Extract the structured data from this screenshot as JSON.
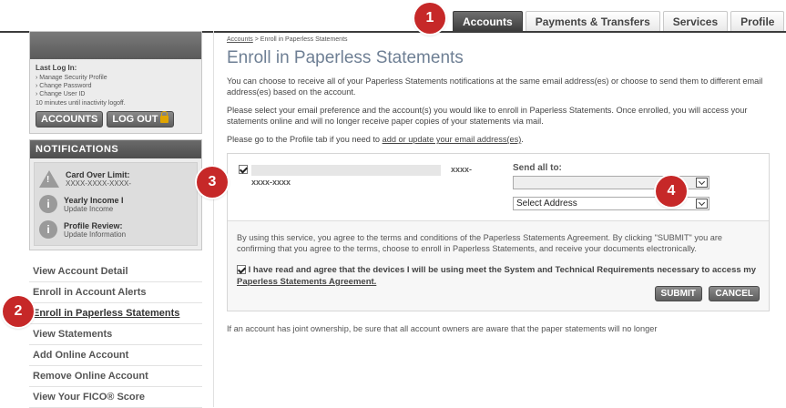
{
  "top_nav": {
    "tabs": [
      {
        "label": "Accounts"
      },
      {
        "label": "Payments & Transfers"
      },
      {
        "label": "Services"
      },
      {
        "label": "Profile"
      }
    ]
  },
  "badges": [
    "1",
    "2",
    "3",
    "4"
  ],
  "sidebar": {
    "last_login_label": "Last Log In:",
    "links": [
      "Manage Security Profile",
      "Change Password",
      "Change User ID"
    ],
    "timeout": "10 minutes until inactivity logoff.",
    "accounts_button": "ACCOUNTS",
    "logout_button": "LOG OUT",
    "notifications": {
      "title": "NOTIFICATIONS",
      "items": [
        {
          "title": "Card Over Limit:",
          "sub": "XXXX-XXXX-XXXX-"
        },
        {
          "title": "Yearly Income I",
          "sub": "Update Income"
        },
        {
          "title": "Profile Review:",
          "sub": "Update Information"
        }
      ]
    },
    "nav": [
      "View Account Detail",
      "Enroll in Account Alerts",
      "Enroll in Paperless Statements",
      "View Statements",
      "Add Online Account",
      "Remove Online Account",
      "View Your FICO® Score"
    ]
  },
  "main": {
    "breadcrumb": {
      "root": "Accounts",
      "sep": ">",
      "current": "Enroll in Paperless Statements"
    },
    "title": "Enroll in Paperless Statements",
    "para1": "You can choose to receive all of your Paperless Statements notifications at the same email address(es) or choose to send them to different email address(es) based on the account.",
    "para2": "Please select your email preference and the account(s) you would like to enroll in Paperless Statements. Once enrolled, you will access your statements online and will no longer receive paper copies of your statements via mail.",
    "para3_prefix": "Please go to the Profile tab if you need to ",
    "para3_link": "add or update your email address(es)",
    "para3_suffix": ".",
    "account": {
      "mask_part1": "xxxx-",
      "mask_part2": "xxxx-xxxx"
    },
    "send_all_label": "Send all to:",
    "email_select_value": "",
    "address_select_value": "Select Address",
    "terms": "By using this service, you agree to the terms and conditions of the Paperless Statements Agreement. By clicking \"SUBMIT\" you are confirming that you agree to the terms, choose to enroll in Paperless Statements, and receive your documents electronically.",
    "agree_text": "I have read and agree that the devices I will be using meet the System and Technical Requirements necessary to access my ",
    "agree_link": "Paperless Statements Agreement.",
    "submit": "SUBMIT",
    "cancel": "CANCEL",
    "footer_note": "If an account has joint ownership, be sure that all account owners are aware that the paper statements will no longer"
  }
}
